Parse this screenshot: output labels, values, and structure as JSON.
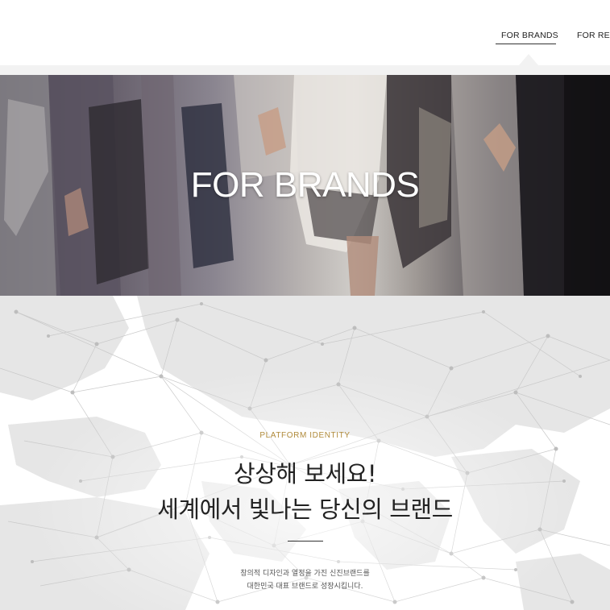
{
  "nav": {
    "items": [
      {
        "label": "FOR BRANDS",
        "active": true
      },
      {
        "label": "FOR RETA"
      }
    ]
  },
  "hero": {
    "title": "FOR BRANDS"
  },
  "identity": {
    "eyebrow": "PLATFORM IDENTITY",
    "headline_line1": "상상해 보세요!",
    "headline_line2": "세계에서 빛나는 당신의 브랜드",
    "description_line1": "창의적 디자인과 열정을 가진 신진브랜드를",
    "description_line2": "대한민국 대표 브랜드로 성장시킵니다."
  },
  "colors": {
    "accent_gold": "#b08a3a",
    "text_dark": "#222222",
    "map_gray": "#d9d9d9"
  }
}
